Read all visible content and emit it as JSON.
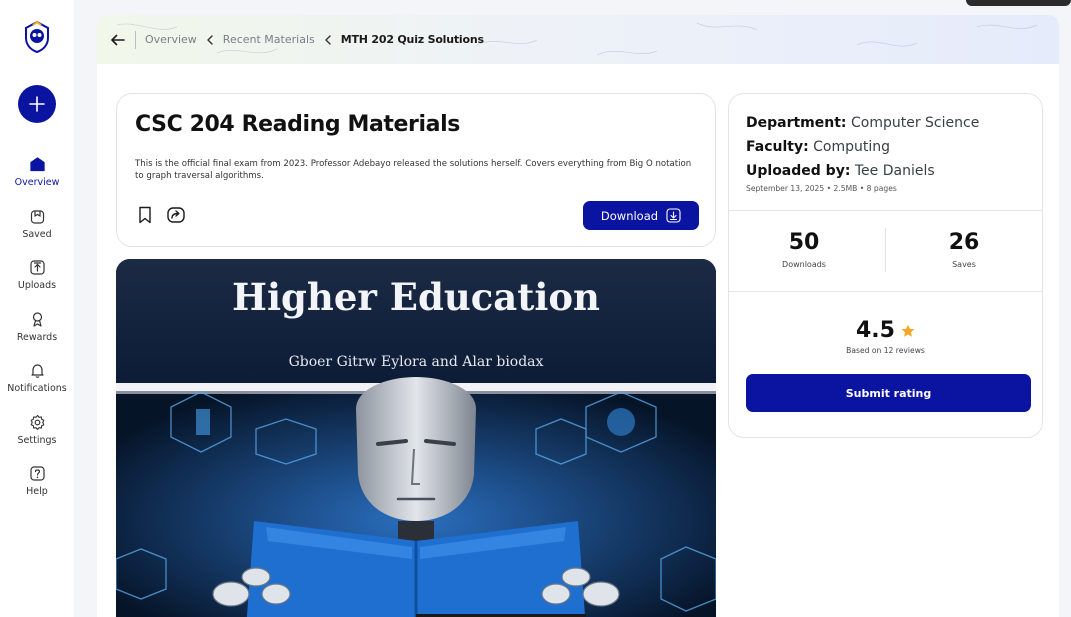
{
  "sidebar": {
    "items": [
      {
        "label": "Overview"
      },
      {
        "label": "Saved"
      },
      {
        "label": "Uploads"
      },
      {
        "label": "Rewards"
      },
      {
        "label": "Notifications"
      },
      {
        "label": "Settings"
      },
      {
        "label": "Help"
      }
    ],
    "active": "Overview"
  },
  "breadcrumb": {
    "items": [
      "Overview",
      "Recent Materials"
    ],
    "current": "MTH 202 Quiz Solutions"
  },
  "document": {
    "title": "CSC 204 Reading Materials",
    "description": "This is the official final exam from 2023. Professor Adebayo released the solutions herself. Covers everything from Big O notation to graph traversal algorithms.",
    "download_label": "Download",
    "preview": {
      "title": "Higher Education",
      "authors": "Gboer Gitrw Eylora and Alar biodax"
    }
  },
  "info": {
    "department_key": "Department:",
    "department": "Computer Science",
    "faculty_key": "Faculty:",
    "faculty": "Computing",
    "uploader_key": "Uploaded by:",
    "uploader": "Tee Daniels",
    "meta": "September 13, 2025 • 2.5MB • 8 pages",
    "downloads": "50",
    "downloads_label": "Downloads",
    "saves": "26",
    "saves_label": "Saves",
    "rating": "4.5",
    "rating_sub": "Based on 12 reviews",
    "submit_label": "Submit rating"
  },
  "colors": {
    "primary": "#0a14a0",
    "star": "#f5a623",
    "background": "#f4f5f8"
  }
}
